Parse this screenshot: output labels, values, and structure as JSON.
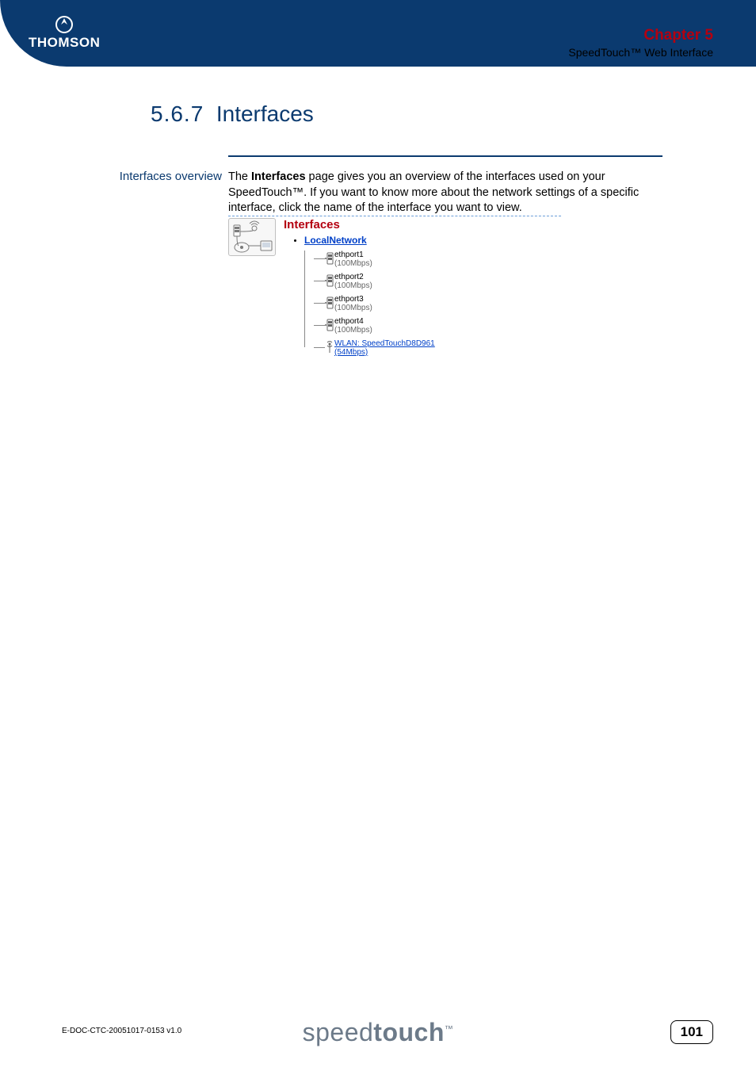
{
  "brand": "THOMSON",
  "chapter": {
    "title": "Chapter 5",
    "subtitle": "SpeedTouch™ Web Interface"
  },
  "section": {
    "number": "5.6.7",
    "title": "Interfaces"
  },
  "sideLabel": "Interfaces overview",
  "body": {
    "pre": "The ",
    "bold": "Interfaces",
    "post": " page gives you an overview of the interfaces used on your SpeedTouch™. If you want to know more about the network settings of a specific interface, click the name of the interface you want to view."
  },
  "panel": {
    "title": "Interfaces",
    "rootLink": "LocalNetwork",
    "ports": [
      {
        "name": "ethport1",
        "speed": "(100Mbps)",
        "type": "eth"
      },
      {
        "name": "ethport2",
        "speed": "(100Mbps)",
        "type": "eth"
      },
      {
        "name": "ethport3",
        "speed": "(100Mbps)",
        "type": "eth"
      },
      {
        "name": "ethport4",
        "speed": "(100Mbps)",
        "type": "eth"
      },
      {
        "name": "WLAN: SpeedTouchD8D961",
        "speed": "(54Mbps)",
        "type": "wlan"
      }
    ]
  },
  "footer": {
    "docid": "E-DOC-CTC-20051017-0153 v1.0",
    "logoLight": "speed",
    "logoBold": "touch",
    "tm": "™",
    "page": "101"
  }
}
